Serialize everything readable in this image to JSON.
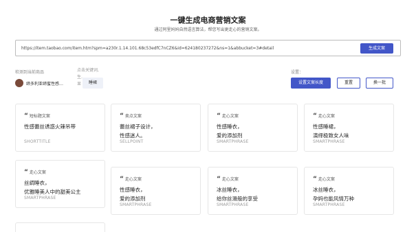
{
  "header": {
    "title": "一键生成电商营销文案",
    "subtitle": "通过阿里妈妈自然语言算法，帮您写出更走心的营销文案。"
  },
  "url_input": {
    "value": "https://item.taobao.com/item.htm?spm=a230r.1.14.101.68c53edfC7nCZ6&id=624180237272&ns=1&abbucket=3#detail",
    "generate_label": "生成文案"
  },
  "detected": {
    "label": "检测到当前商品",
    "product_name": "缔多利亚缔蜜性感…"
  },
  "keywords": {
    "line1": "点击关键词,",
    "line2": "生...",
    "line3": "显",
    "chip": "睡裙"
  },
  "settings": {
    "label": "设置：",
    "set_length_label": "设置文案长度",
    "reset_label": "重置",
    "swap_label": "换一批"
  },
  "cards": [
    {
      "tag": "短标题文案",
      "lines": [
        "性感蕾丝诱惑火辣吊带"
      ],
      "type": "SHORTTITLE"
    },
    {
      "tag": "卖点文案",
      "lines": [
        "蕾丝裙子设计，",
        "性感迷人。"
      ],
      "type": "SELLPOINT"
    },
    {
      "tag": "走心文案",
      "lines": [
        "性感睡衣，",
        "爱的添加剂"
      ],
      "type": "SMARTPHRASE"
    },
    {
      "tag": "走心文案",
      "lines": [
        "性感睡裙，",
        "演绎极致女人味"
      ],
      "type": "SMARTPHRASE"
    },
    {
      "tag": "走心文案",
      "lines": [
        "丝绸睡衣，",
        "优雅睡美人中的甜美公主"
      ],
      "type": "SMARTPHRASE"
    },
    {
      "tag": "走心文案",
      "lines": [
        "性感睡衣，",
        "爱的添加剂"
      ],
      "type": "SMARTPHRASE"
    },
    {
      "tag": "走心文案",
      "lines": [
        "冰丝睡衣，",
        "给你丝滑般的享受"
      ],
      "type": "SMARTPHRASE"
    },
    {
      "tag": "走心文案",
      "lines": [
        "冰丝睡衣，",
        "孕妈也能风情万种"
      ],
      "type": "SMARTPHRASE"
    }
  ],
  "colors": {
    "accent": "#4256c8"
  }
}
